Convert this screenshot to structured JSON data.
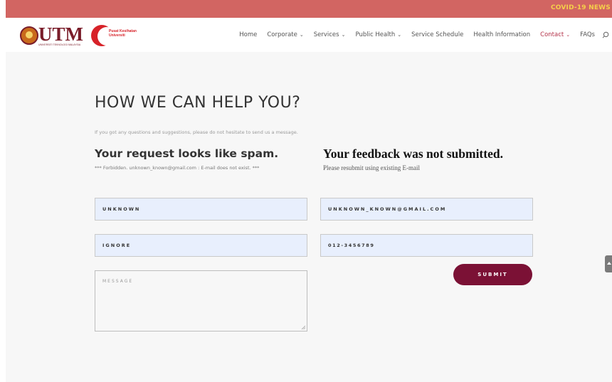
{
  "topbar": {
    "news_label": "COVID-19 NEWS"
  },
  "logo": {
    "name": "UTM",
    "subtitle": "UNIVERSITI TEKNOLOGI MALAYSIA",
    "clinic": "Pusat Kesihatan Universiti"
  },
  "nav": {
    "items": [
      {
        "label": "Home",
        "chevron": false
      },
      {
        "label": "Corporate",
        "chevron": true
      },
      {
        "label": "Services",
        "chevron": true
      },
      {
        "label": "Public Health",
        "chevron": true
      },
      {
        "label": "Service Schedule",
        "chevron": false
      },
      {
        "label": "Health Information",
        "chevron": false
      },
      {
        "label": "Contact",
        "chevron": true,
        "active": true
      },
      {
        "label": "FAQs",
        "chevron": false
      }
    ],
    "chevron_glyph": "⌄"
  },
  "page": {
    "title": "HOW WE CAN HELP YOU?",
    "intro": "If you got any questions and suggestions, please do not hesitate to send us a message.",
    "spam_title": "Your request looks like spam.",
    "spam_detail": "*** Forbidden. unknown_known@gmail.com : E-mail does not exist. ***",
    "feedback_title": "Your feedback was not submitted.",
    "feedback_detail": "Please resubmit using existing E-mail"
  },
  "form": {
    "name_value": "UNKNOWN",
    "email_value": "UNKNOWN_KNOWN@GMAIL.COM",
    "subject_value": "IGNORE",
    "phone_value": "012-3456789",
    "message_placeholder": "MESSAGE",
    "submit_label": "SUBMIT"
  },
  "colors": {
    "topbar": "#d26562",
    "news": "#f5d04a",
    "brand": "#7a1d2a",
    "submit": "#7b1135",
    "field_bg": "#e8effd",
    "active_nav": "#b4334a"
  }
}
